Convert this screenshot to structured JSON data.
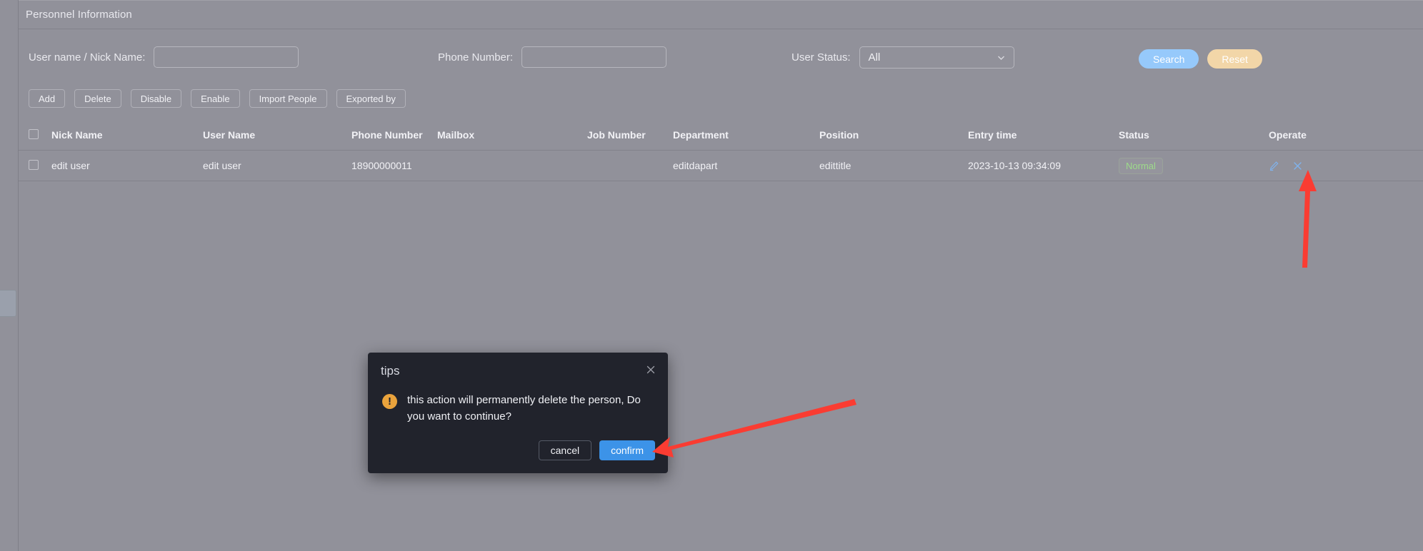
{
  "panel": {
    "title": "Personnel Information"
  },
  "filters": {
    "username_label": "User name / Nick Name:",
    "username_value": "",
    "username_placeholder": "",
    "phone_label": "Phone Number:",
    "phone_value": "",
    "phone_placeholder": "",
    "status_label": "User Status:",
    "status_value": "All",
    "status_options": [
      "All"
    ],
    "search_label": "Search",
    "reset_label": "Reset",
    "search_color": "#96c9fb",
    "reset_color": "#f2d6a8"
  },
  "toolbar": {
    "buttons": [
      {
        "label": "Add"
      },
      {
        "label": "Delete"
      },
      {
        "label": "Disable"
      },
      {
        "label": "Enable"
      },
      {
        "label": "Import People"
      },
      {
        "label": "Exported by"
      }
    ]
  },
  "table": {
    "columns": [
      "Nick Name",
      "User Name",
      "Phone Number",
      "Mailbox",
      "Job Number",
      "Department",
      "Position",
      "Entry time",
      "Status",
      "Operate"
    ],
    "rows": [
      {
        "nick_name": "edit user",
        "user_name": "edit user",
        "phone_number": "18900000011",
        "mailbox": "",
        "job_number": "",
        "department": "editdapart",
        "position": "edittitle",
        "entry_time": "2023-10-13 09:34:09",
        "status": "Normal",
        "status_color": "#9ddb8a"
      }
    ]
  },
  "modal": {
    "title": "tips",
    "message": "this action will permanently delete the person, Do you want to continue?",
    "cancel_label": "cancel",
    "confirm_label": "confirm",
    "confirm_color": "#3c93e8",
    "warning_glyph": "!"
  },
  "annotations": {
    "arrow_color": "#fa3c32",
    "arrow_to_delete_icon": "points at the row delete (X) icon",
    "arrow_to_confirm_button": "points at the confirm button"
  }
}
